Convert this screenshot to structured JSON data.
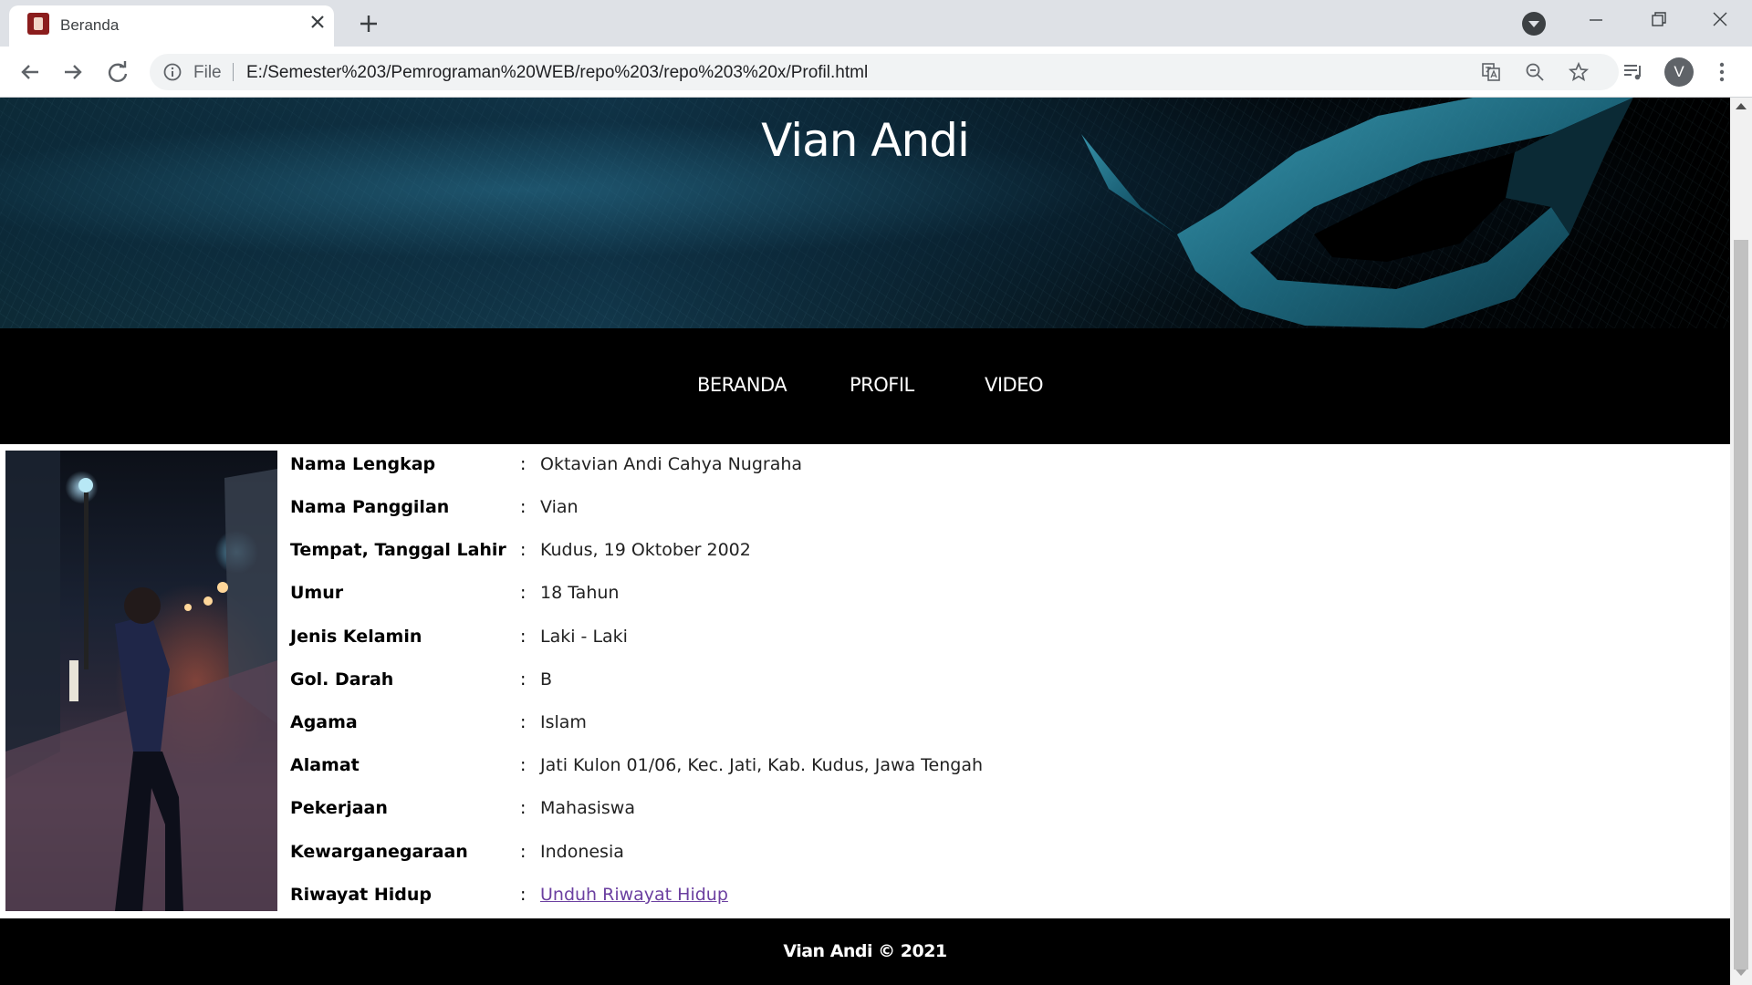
{
  "browser": {
    "tab_title": "Beranda",
    "address_scheme": "File",
    "address_url": "E:/Semester%203/Pemrograman%20WEB/repo%203/repo%203%20x/Profil.html",
    "avatar_letter": "V",
    "icons": [
      "back-icon",
      "forward-icon",
      "reload-icon",
      "info-icon",
      "translate-icon",
      "zoom-out-icon",
      "star-icon",
      "media-queue-icon",
      "menu-icon"
    ]
  },
  "site": {
    "title": "Vian Andi",
    "nav": [
      "BERANDA",
      "PROFIL",
      "VIDEO"
    ],
    "footer": "Vian Andi © 2021"
  },
  "profile": {
    "rows": [
      {
        "label": "Nama Lengkap",
        "value": "Oktavian Andi Cahya Nugraha"
      },
      {
        "label": "Nama Panggilan",
        "value": "Vian"
      },
      {
        "label": "Tempat, Tanggal Lahir",
        "value": "Kudus, 19 Oktober 2002"
      },
      {
        "label": "Umur",
        "value": "18 Tahun"
      },
      {
        "label": "Jenis Kelamin",
        "value": "Laki - Laki"
      },
      {
        "label": "Gol. Darah",
        "value": "B"
      },
      {
        "label": "Agama",
        "value": "Islam"
      },
      {
        "label": "Alamat",
        "value": "Jati Kulon 01/06, Kec. Jati, Kab. Kudus, Jawa Tengah"
      },
      {
        "label": "Pekerjaan",
        "value": "Mahasiswa"
      },
      {
        "label": "Kewarganegaraan",
        "value": "Indonesia"
      },
      {
        "label": "Riwayat Hidup",
        "value": "Unduh Riwayat Hidup"
      }
    ],
    "colon": ":"
  },
  "colors": {
    "chrome_bg": "#dee1e6",
    "nav_bg": "#000000",
    "link": "#6b3fa0"
  }
}
